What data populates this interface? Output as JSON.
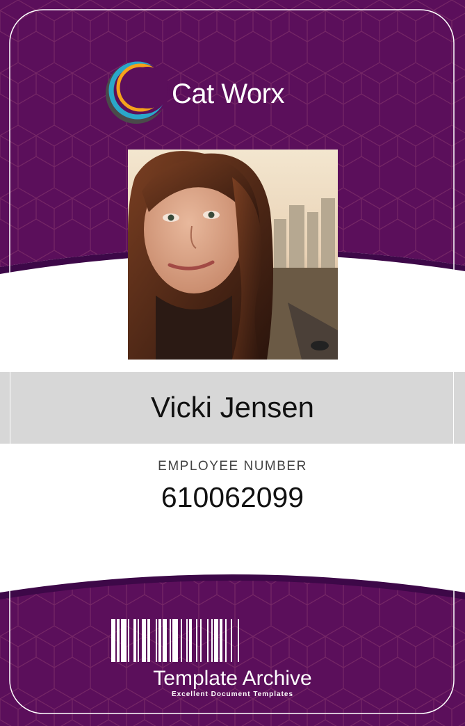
{
  "company": {
    "name": "Cat Worx",
    "logo_icon": "crescent-rings-logo"
  },
  "employee": {
    "name": "Vicki Jensen",
    "number_label": "EMPLOYEE NUMBER",
    "number": "610062099",
    "photo": "employee-portrait-photo"
  },
  "footer": {
    "barcode_icon": "barcode-icon",
    "brand": "Template Archive",
    "tagline": "Excellent Document Templates"
  },
  "colors": {
    "primary_purple": "#5b0f5b",
    "dark_purple": "#3d0848",
    "band_gray": "#d7d7d7"
  }
}
